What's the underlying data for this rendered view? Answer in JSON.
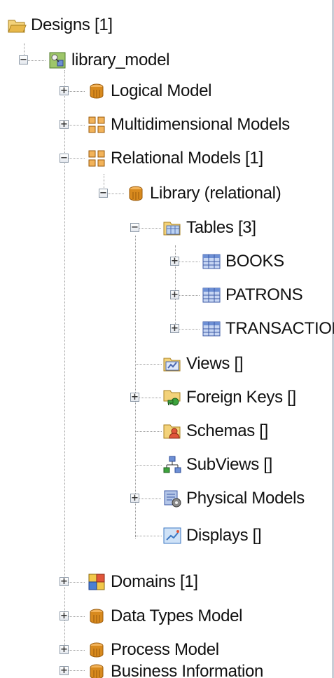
{
  "tree": {
    "designs": "Designs [1]",
    "library_model": "library_model",
    "logical_model": "Logical Model",
    "multidimensional_models": "Multidimensional Models",
    "relational_models": "Relational Models [1]",
    "library_relational": "Library (relational)",
    "tables": "Tables [3]",
    "books": "BOOKS",
    "patrons": "PATRONS",
    "transactions": "TRANSACTIONS",
    "views": "Views []",
    "foreign_keys": "Foreign Keys []",
    "schemas": "Schemas []",
    "subviews": "SubViews []",
    "physical_models": "Physical Models",
    "displays": "Displays []",
    "domains": "Domains [1]",
    "data_types_model": "Data Types Model",
    "process_model": "Process Model",
    "business_information": "Business Information"
  },
  "icons": {
    "designs": "folder-open-icon",
    "library_model": "design-model-icon",
    "logical_model": "model-cylinder-icon",
    "multidimensional_models": "multidim-grid-icon",
    "relational_models": "multidim-grid-icon",
    "library_relational": "model-cylinder-icon",
    "tables": "folder-open-icon",
    "books": "table-icon",
    "patrons": "table-icon",
    "transactions": "table-icon",
    "views": "views-icon",
    "foreign_keys": "key-icon",
    "schemas": "schema-icon",
    "subviews": "subviews-icon",
    "physical_models": "physical-model-icon",
    "displays": "display-icon",
    "domains": "domains-icon",
    "data_types_model": "model-cylinder-icon",
    "process_model": "model-cylinder-icon",
    "business_information": "model-cylinder-icon"
  },
  "colors": {
    "folder": "#e8b84a",
    "cylinder": "#d88a1e",
    "grid": "#d27a1a",
    "table": "#6d8fd4",
    "tree_line": "#9a9a9a"
  }
}
